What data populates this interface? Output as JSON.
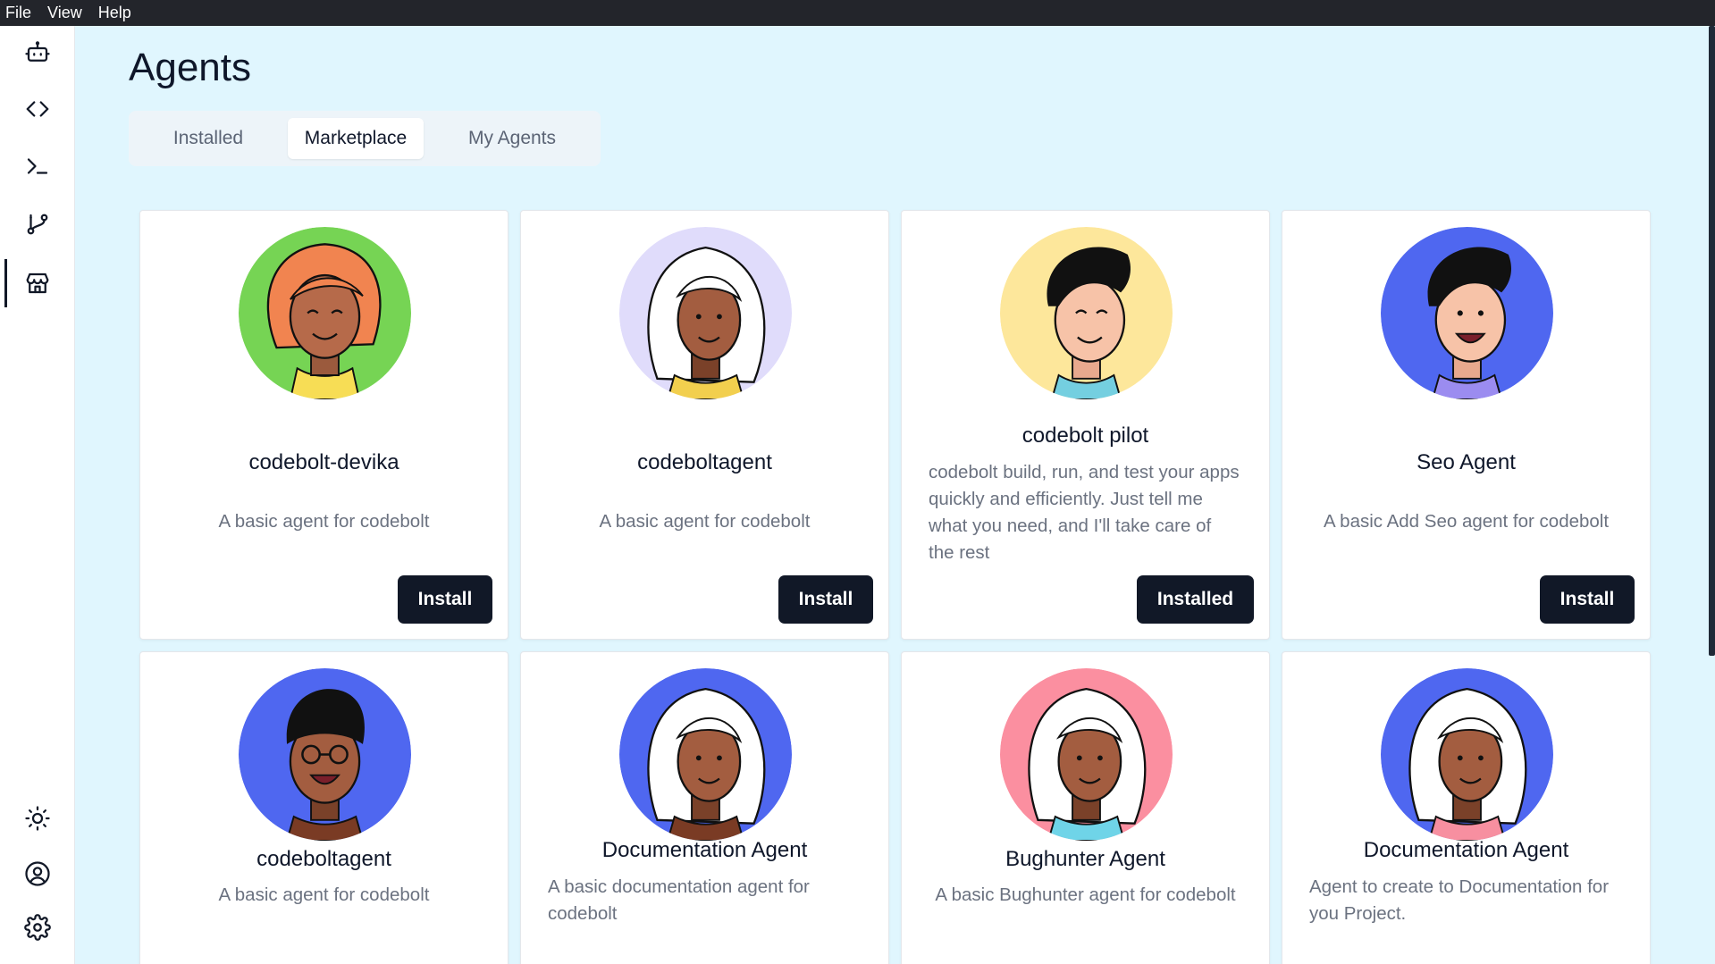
{
  "menu": [
    "File",
    "View",
    "Help"
  ],
  "page": {
    "title": "Agents"
  },
  "tabs": [
    {
      "label": "Installed",
      "active": false
    },
    {
      "label": "Marketplace",
      "active": true
    },
    {
      "label": "My Agents",
      "active": false
    }
  ],
  "agents": [
    {
      "name": "codebolt-devika",
      "description": "A basic agent for codebolt",
      "button": "Install",
      "avatar_bg": "#76d454"
    },
    {
      "name": "codeboltagent",
      "description": "A basic agent for codebolt",
      "button": "Install",
      "avatar_bg": "#e0dcfb"
    },
    {
      "name": "codebolt pilot",
      "description": "codebolt build, run, and test your apps quickly and efficiently. Just tell me what you need, and I'll take care of the rest",
      "button": "Installed",
      "avatar_bg": "#fde79b"
    },
    {
      "name": "Seo Agent",
      "description": "A basic Add Seo agent for codebolt",
      "button": "Install",
      "avatar_bg": "#4f67f0"
    },
    {
      "name": "codeboltagent",
      "description": "A basic agent for codebolt",
      "avatar_bg": "#4f67f0"
    },
    {
      "name": "Documentation Agent",
      "description": "A basic documentation agent for codebolt",
      "avatar_bg": "#4f67f0"
    },
    {
      "name": "Bughunter Agent",
      "description": "A basic Bughunter agent for codebolt",
      "avatar_bg": "#fb8fa0"
    },
    {
      "name": "Documentation Agent",
      "description": "Agent to create to Documentation for you Project.",
      "avatar_bg": "#4f67f0"
    }
  ],
  "sidebar": {
    "icons": [
      "robot-icon",
      "code-icon",
      "terminal-icon",
      "git-branch-icon",
      "store-icon",
      "sun-icon",
      "user-circle-icon",
      "settings-icon"
    ]
  }
}
